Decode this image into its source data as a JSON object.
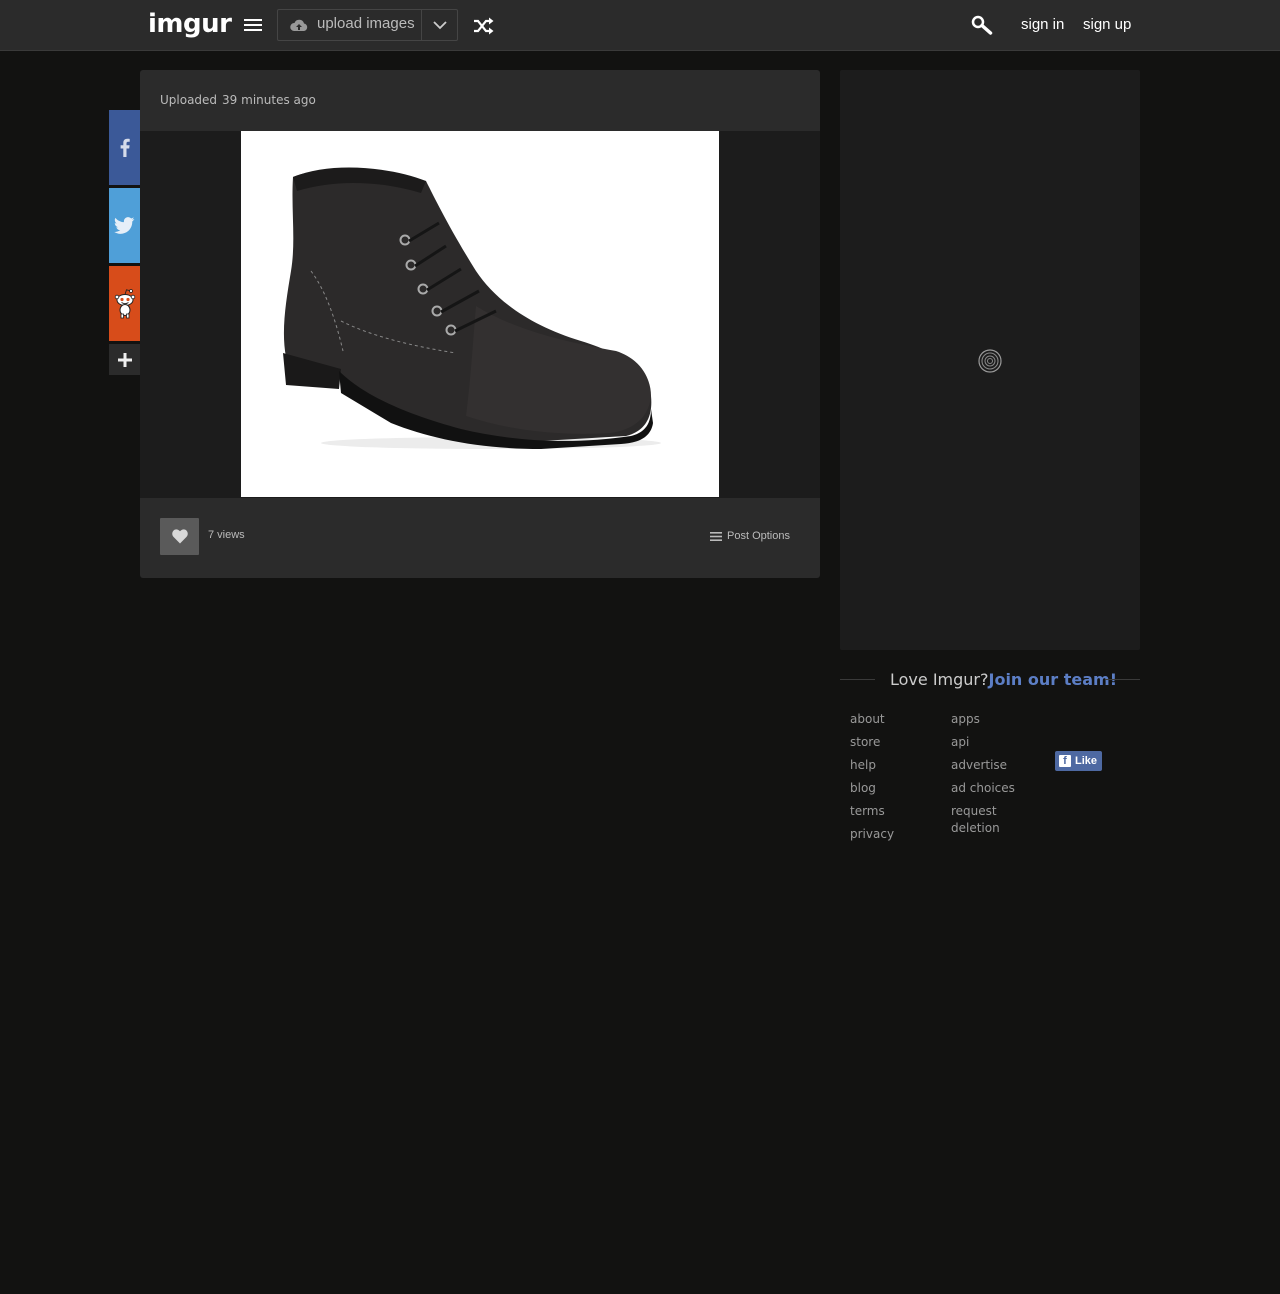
{
  "header": {
    "logo_text": "imgur",
    "upload_label": "upload images",
    "sign_in": "sign in",
    "sign_up": "sign up"
  },
  "post": {
    "uploaded_label": "Uploaded",
    "uploaded_time": "39 minutes ago",
    "views": "7 views",
    "post_options": "Post Options"
  },
  "sidebar": {
    "love_text": "Love Imgur?",
    "join_text": "Join our team!"
  },
  "footer": {
    "col1": [
      "about",
      "store",
      "help",
      "blog",
      "terms",
      "privacy"
    ],
    "col2": [
      "apps",
      "api",
      "advertise",
      "ad choices",
      "request deletion"
    ],
    "fb_like": "Like"
  },
  "colors": {
    "background": "#121211",
    "panel": "#2b2b2b",
    "accent_link": "#5c7ec5",
    "facebook": "#3b5998",
    "twitter": "#4f9fd8",
    "reddit": "#d74c1a"
  }
}
